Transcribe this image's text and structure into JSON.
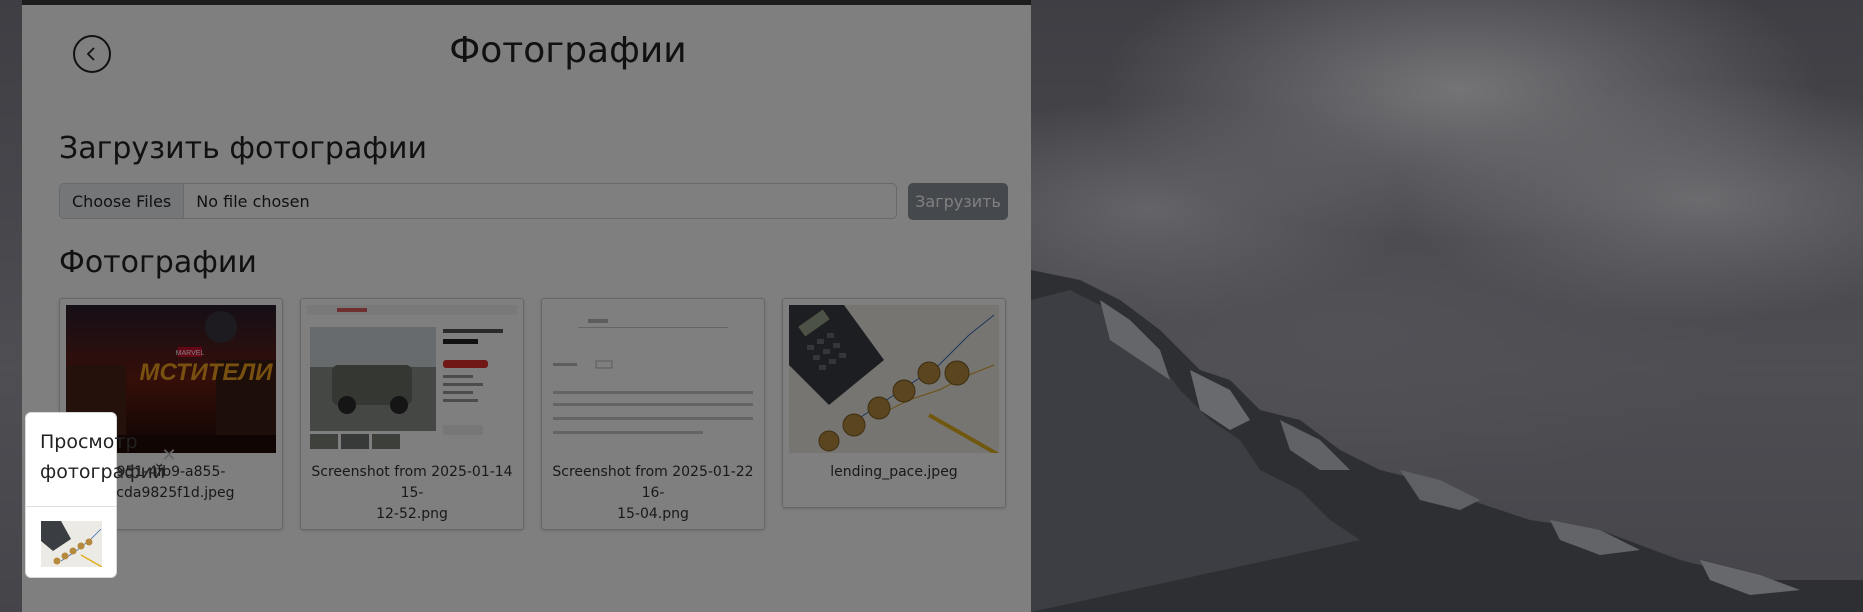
{
  "page": {
    "title": "Фотографии",
    "back_icon": "chevron-left-icon"
  },
  "upload": {
    "heading": "Загрузить фотографии",
    "choose_label": "Choose Files",
    "file_status": "No file chosen",
    "submit_label": "Загрузить"
  },
  "gallery": {
    "heading": "Фотографии",
    "photos": [
      {
        "caption": "…951-4fb9-a855-…bcda9825f1d.jpeg",
        "caption_line1": "951-4fb9-a855-",
        "caption_line2": "bcda9825f1d.jpeg"
      },
      {
        "caption_line1": "Screenshot from 2025-01-14 15-",
        "caption_line2": "12-52.png"
      },
      {
        "caption_line1": "Screenshot from 2025-01-22 16-",
        "caption_line2": "15-04.png"
      },
      {
        "caption_line1": "lending_pace.jpeg",
        "caption_line2": ""
      }
    ]
  },
  "viewer": {
    "title_line1": "Просмотр",
    "title_line2": "фотографий",
    "close_icon": "close-icon"
  },
  "colors": {
    "window_bg": "#ffffff",
    "upload_button": "#8a9199",
    "overlay": "rgba(0,0,0,0.5)"
  }
}
